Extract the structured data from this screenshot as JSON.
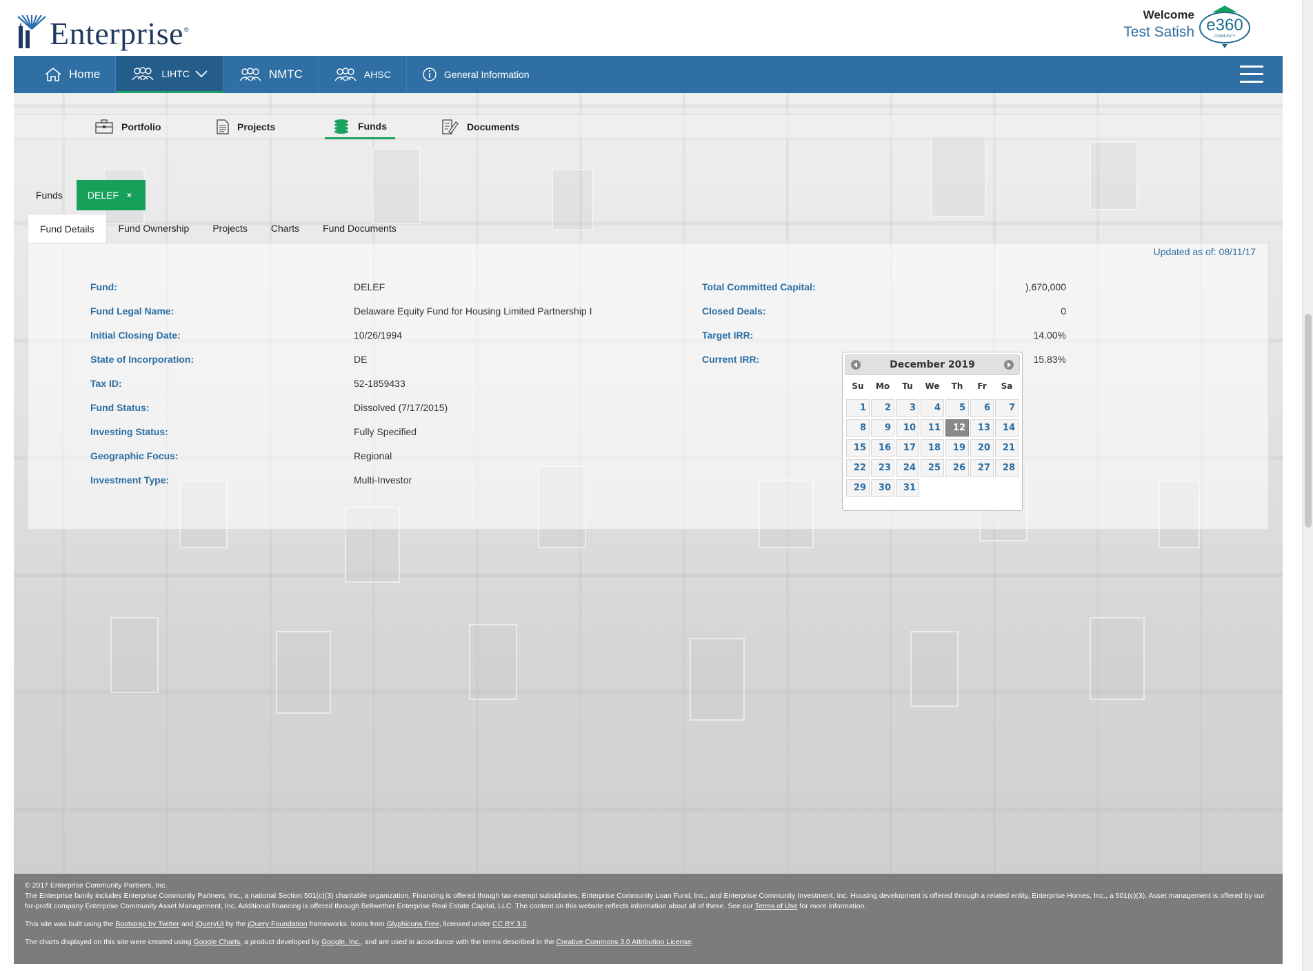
{
  "header": {
    "logo_text": "Enterprise",
    "logo_reg": "®",
    "welcome_label": "Welcome",
    "user_name": "Test Satish",
    "e360_text": "e360",
    "e360_sub": "COMMUNITY"
  },
  "topnav": {
    "items": [
      {
        "label": "Home",
        "icon": "home-icon"
      },
      {
        "label": "LIHTC",
        "icon": "people-icon",
        "active": true,
        "dropdown": true
      },
      {
        "label": "NMTC",
        "icon": "people-icon"
      },
      {
        "label": "AHSC",
        "icon": "people-icon"
      },
      {
        "label": "General Information",
        "icon": "info-icon"
      }
    ],
    "menu_icon": "hamburger-icon"
  },
  "subnav": {
    "items": [
      {
        "label": "Portfolio",
        "icon": "briefcase-icon"
      },
      {
        "label": "Projects",
        "icon": "document-icon"
      },
      {
        "label": "Funds",
        "icon": "coins-icon",
        "active": true
      },
      {
        "label": "Documents",
        "icon": "edit-document-icon"
      }
    ]
  },
  "fund_tabs": {
    "label": "Funds",
    "chip": "DELEF",
    "chip_close": "×"
  },
  "detail_tabs": [
    "Fund Details",
    "Fund Ownership",
    "Projects",
    "Charts",
    "Fund Documents"
  ],
  "fund_details": {
    "updated": "Updated as of: 08/11/17",
    "left": [
      {
        "label": "Fund:",
        "value": "DELEF"
      },
      {
        "label": "Fund Legal Name:",
        "value": "Delaware Equity Fund for Housing Limited Partnership I"
      },
      {
        "label": "Initial Closing Date:",
        "value": "10/26/1994"
      },
      {
        "label": "State of Incorporation:",
        "value": "DE"
      },
      {
        "label": "Tax ID:",
        "value": "52-1859433"
      },
      {
        "label": "Fund Status:",
        "value": "Dissolved (7/17/2015)"
      },
      {
        "label": "Investing Status:",
        "value": "Fully Specified"
      },
      {
        "label": "Geographic Focus:",
        "value": "Regional"
      },
      {
        "label": "Investment Type:",
        "value": "Multi-Investor"
      }
    ],
    "right": [
      {
        "label": "Total Committed Capital:",
        "value": "),670,000"
      },
      {
        "label": "Closed Deals:",
        "value": "0"
      },
      {
        "label": "Target IRR:",
        "value": "14.00%"
      },
      {
        "label": "Current IRR:",
        "value": "15.83%"
      }
    ]
  },
  "datepicker": {
    "title": "December 2019",
    "weekdays": [
      "Su",
      "Mo",
      "Tu",
      "We",
      "Th",
      "Fr",
      "Sa"
    ],
    "first_weekday_index": 0,
    "days_in_month": 31,
    "highlighted_day": 12
  },
  "footer": {
    "copyright": "© 2017 Enterprise Community Partners, Inc.",
    "disclaimer_1": "The Enterprise family includes Enterprise Community Partners, Inc., a national Section 501(c)(3) charitable organization. Financing is offered though tax-exempt subsidiaries, Enterprise Community Loan Fund, Inc., and Enterprise Community Investment, Inc. Housing development is offered through a related entity, Enterprise Homes, Inc., a 501(c)(3). Asset management is offered by our for-profit company Enterprise Community Asset Management, Inc. Additional financing is offered through Bellwether Enterprise Real Estate Capital, LLC. The content on this website reflects information about all of these. See our ",
    "terms_link": "Terms of Use",
    "disclaimer_2": " for more information.",
    "built_1": "This site was built using the ",
    "bootstrap_link": "Bootstrap by Twitter",
    "built_2": " and ",
    "jqueryui_link": "jQueryUI",
    "built_3": " by the ",
    "jqueryfoundation_link": "jQuery Foundation",
    "built_4": " frameworks. Icons from ",
    "glyphicons_link": "Glyphicons Free",
    "built_5": ", licensed under ",
    "ccby_link": "CC BY 3.0",
    "built_6": ".",
    "charts_1": "The charts displayed on this site were created using ",
    "googlecharts_link": "Google Charts",
    "charts_2": ", a product developed by ",
    "google_link": "Google, Inc.",
    "charts_3": ", and are used in accordance with the terms described in the ",
    "cc_attr_link": "Creative Commons 3.0 Attribution License",
    "charts_4": "."
  },
  "colors": {
    "nav_blue": "#2f6fa3",
    "accent_green": "#16a05a",
    "label_blue": "#2c6ea2",
    "footer_gray": "#7c7c7c"
  }
}
